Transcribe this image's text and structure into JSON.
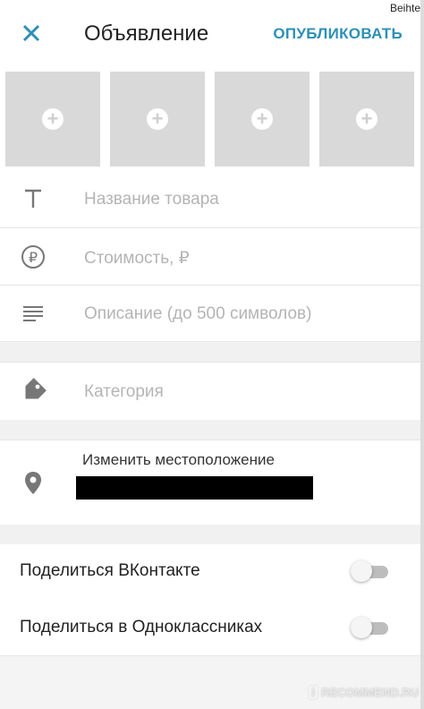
{
  "corner_text": "Beihte",
  "header": {
    "title": "Объявление",
    "publish_label": "ОПУБЛИКОВАТЬ"
  },
  "photos": {
    "slot_icon": "plus-circle-icon",
    "slots": 4
  },
  "form": {
    "title_placeholder": "Название товара",
    "price_placeholder": "Стоимость, ₽",
    "description_placeholder": "Описание (до 500 символов)",
    "category_placeholder": "Категория"
  },
  "location": {
    "label": "Изменить местоположение"
  },
  "share": {
    "vk_label": "Поделиться ВКонтакте",
    "vk_enabled": false,
    "ok_label": "Поделиться в Одноклассниках",
    "ok_enabled": false
  },
  "watermark": "RECOMMEND.RU",
  "colors": {
    "accent": "#2d8fb7",
    "placeholder": "#b4b4b4",
    "photo_slot": "#d9d9d9"
  }
}
